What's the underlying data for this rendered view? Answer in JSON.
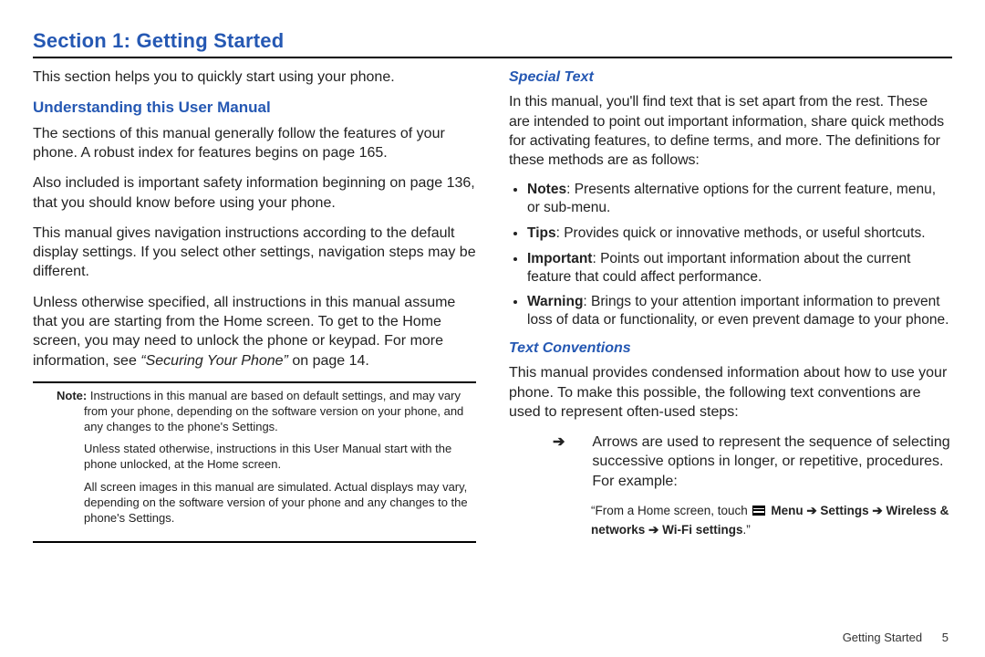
{
  "title": "Section 1: Getting Started",
  "intro": "This section helps you to quickly start using your phone.",
  "left": {
    "h_understanding": "Understanding this User Manual",
    "p1": "The sections of this manual generally follow the features of your phone. A robust index for features begins on page 165.",
    "p2": "Also included is important safety information beginning on page 136, that you should know before using your phone.",
    "p3": "This manual gives navigation instructions according to the default display settings. If you select other settings, navigation steps may be different.",
    "p4_a": "Unless otherwise specified, all instructions in this manual assume that you are starting from the Home screen. To get to the Home screen, you may need to unlock the phone or keypad. For more information, see ",
    "p4_em": "“Securing Your Phone”",
    "p4_b": " on page 14.",
    "note_label": "Note:",
    "note1_rest": "Instructions in this manual are based on default settings, and may vary from your phone, depending on the software version on your phone, and any changes to the phone's Settings.",
    "note2": "Unless stated otherwise, instructions in this User Manual start with the phone unlocked, at the Home screen.",
    "note3": "All screen images in this manual are simulated. Actual displays may vary, depending on the software version of your phone and any changes to the phone's Settings."
  },
  "right": {
    "h_special": "Special Text",
    "special_p": "In this manual, you'll find text that is set apart from the rest. These are intended to point out important information, share quick methods for activating features, to define terms, and more. The definitions for these methods are as follows:",
    "bullets": [
      {
        "term": "Notes",
        "text": ": Presents alternative options for the current feature, menu, or sub-menu."
      },
      {
        "term": "Tips",
        "text": ": Provides quick or innovative methods, or useful shortcuts."
      },
      {
        "term": "Important",
        "text": ": Points out important information about the current feature that could affect performance."
      },
      {
        "term": "Warning",
        "text": ": Brings to your attention important information to prevent loss of data or functionality, or even prevent damage to your phone."
      }
    ],
    "h_textconv": "Text Conventions",
    "textconv_p": "This manual provides condensed information about how to use your phone. To make this possible, the following text conventions are used to represent often-used steps:",
    "arrow_symbol": "➔",
    "arrow_text": "Arrows are used to represent the sequence of selecting successive options in longer, or repetitive, procedures. For example:",
    "example_a": "“From a Home screen, touch ",
    "example_menu": "Menu",
    "example_arrow1": " ➔ ",
    "example_settings": "Settings",
    "example_arrow2": " ➔ ",
    "example_wireless": "Wireless & networks",
    "example_arrow3": " ➔ ",
    "example_wifi": "Wi-Fi settings",
    "example_end": ".”"
  },
  "footer": {
    "section": "Getting Started",
    "page": "5"
  }
}
